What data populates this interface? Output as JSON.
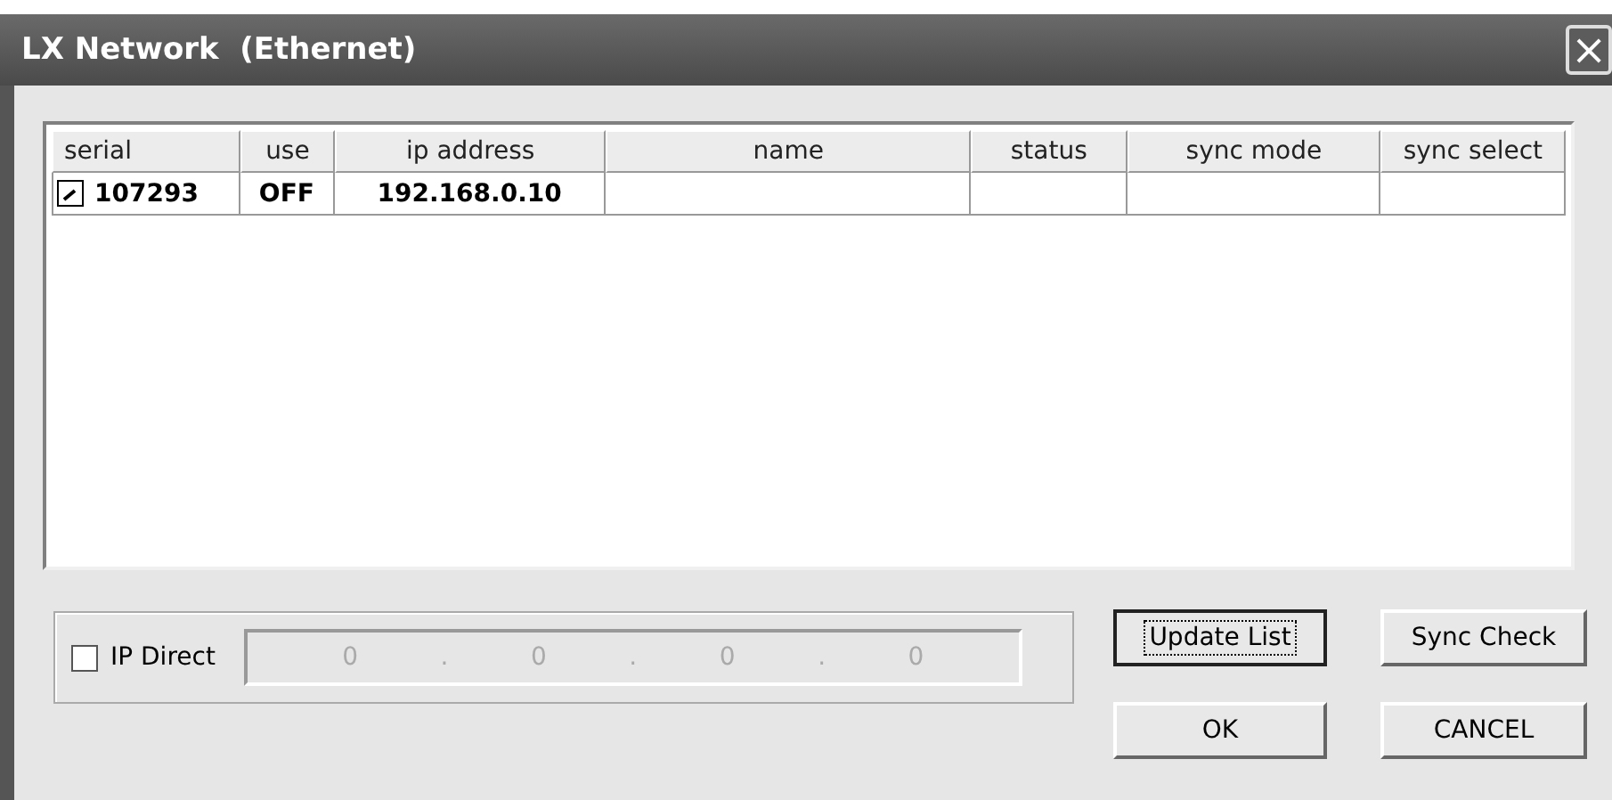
{
  "window": {
    "title": "LX Network  (Ethernet)",
    "close": "×"
  },
  "table": {
    "columns": [
      "serial",
      "use",
      "ip address",
      "name",
      "status",
      "sync mode",
      "sync select"
    ],
    "rows": [
      {
        "checked": true,
        "cells": [
          "107293",
          "OFF",
          "192.168.0.10"
        ]
      }
    ]
  },
  "ip_direct": {
    "label": "IP Direct",
    "checked": false,
    "disabled": true,
    "octets": [
      "0",
      "0",
      "0",
      "0"
    ],
    "separator": "."
  },
  "buttons": [
    {
      "label": "Update List",
      "focused": true
    },
    {
      "label": "Sync Check",
      "focused": false
    },
    {
      "label": "OK",
      "focused": false
    },
    {
      "label": "CANCEL",
      "focused": false
    }
  ]
}
